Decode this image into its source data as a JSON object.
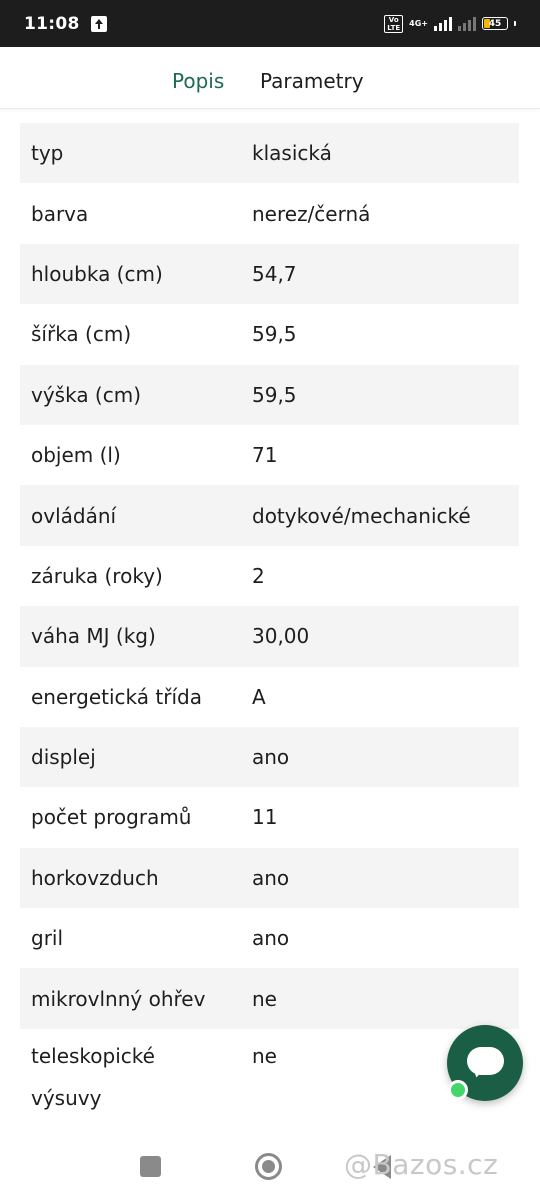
{
  "status_bar": {
    "time": "11:08",
    "network": "4G+",
    "battery": "45"
  },
  "tabs": [
    {
      "label": "Popis",
      "active": true
    },
    {
      "label": "Parametry",
      "active": false
    }
  ],
  "parameters": [
    {
      "key": "typ",
      "value": "klasická"
    },
    {
      "key": "barva",
      "value": "nerez/černá"
    },
    {
      "key": "hloubka (cm)",
      "value": "54,7"
    },
    {
      "key": "šířka (cm)",
      "value": "59,5"
    },
    {
      "key": "výška (cm)",
      "value": "59,5"
    },
    {
      "key": "objem (l)",
      "value": "71"
    },
    {
      "key": "ovládání",
      "value": "dotykové/mechanické"
    },
    {
      "key": "záruka (roky)",
      "value": "2"
    },
    {
      "key": "váha MJ (kg)",
      "value": "30,00"
    },
    {
      "key": "energetická třída",
      "value": "A"
    },
    {
      "key": "displej",
      "value": "ano"
    },
    {
      "key": "počet programů",
      "value": "11"
    },
    {
      "key": "horkovzduch",
      "value": "ano"
    },
    {
      "key": "gril",
      "value": "ano"
    },
    {
      "key": "mikrovlnný ohřev",
      "value": "ne"
    },
    {
      "key": "teleskopické výsuvy",
      "value": "ne"
    }
  ],
  "watermark": "@Bazos.cz",
  "colors": {
    "accent": "#1d6a54",
    "fab": "#1a5e45",
    "online": "#42d66b",
    "row_stripe": "#f4f4f4"
  }
}
